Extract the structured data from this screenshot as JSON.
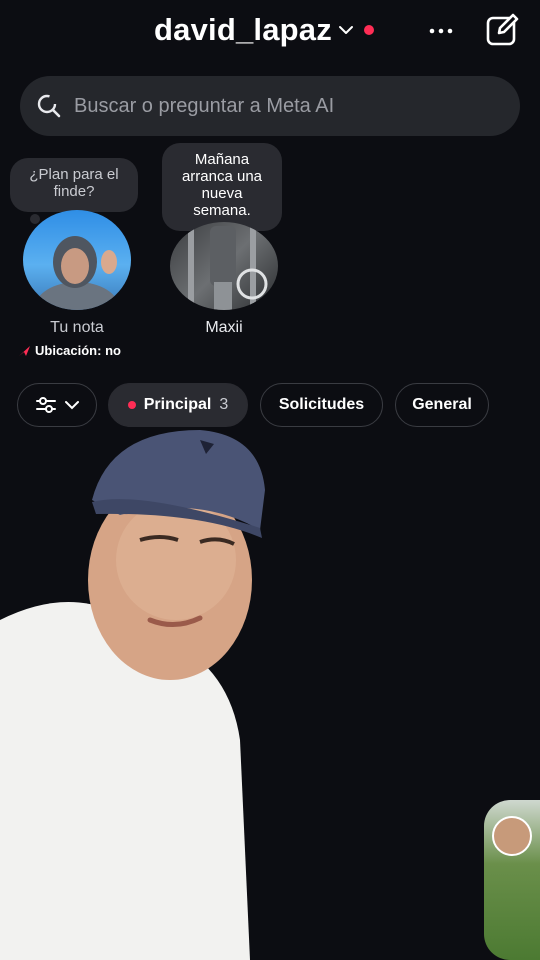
{
  "header": {
    "username": "david_lapaz",
    "icons": {
      "chevron": "chevron-down-icon",
      "more": "more-icon",
      "compose": "compose-icon"
    },
    "accent": "#ff2d55"
  },
  "search": {
    "placeholder": "Buscar o preguntar a Meta AI",
    "icon": "meta-ai-search-icon"
  },
  "notes": [
    {
      "bubble": "¿Plan para el finde?",
      "label": "Tu nota",
      "extra": "Ubicación: no"
    },
    {
      "bubble": "Mañana arranca una nueva semana.",
      "label": "Maxii"
    }
  ],
  "filters": {
    "principal": {
      "label": "Principal",
      "count": "3"
    },
    "solicitudes": "Solicitudes",
    "general": "General"
  },
  "colors": {
    "background": "#0c0d12",
    "chip": "#2a2b31",
    "search": "#25272c"
  }
}
